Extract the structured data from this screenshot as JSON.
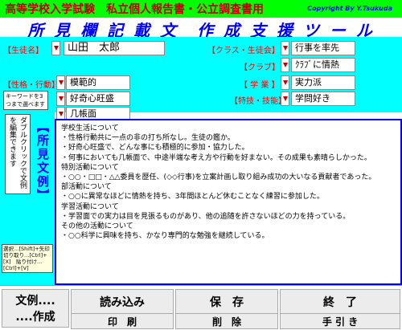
{
  "header": {
    "top_title": "高等学校入学試験　私立個人報告書・公立調査書用",
    "copyright": "Copyright By Y.Tsukuda",
    "main_title": "所 見 欄 記 載 文　作 成 支 援 ツ ー ル"
  },
  "fields": {
    "student_label": "【生徒名】",
    "student_value": "山田　太郎",
    "class_committee_label": "【クラス・生徒会】",
    "class_committee_value": "行事を率先",
    "club_label": "【クラブ】",
    "club_value": "ｸﾗﾌﾞに情熱",
    "personality_label": "【性格・行動】",
    "personality_values": [
      "模範的",
      "好奇心旺盛",
      "几帳面"
    ],
    "study_label": "【 学 業 】",
    "study_value": "実力派",
    "special_label": "【特技・技能】",
    "special_value": "学問好き"
  },
  "left_panel": {
    "keyword_note": "キーワードを3つまで選べます",
    "double_click_note": "ダブルクリックで文例を編集できます",
    "example_title": "【所見文例】",
    "hint": "選択…[Shift]+矢印　切り取り…[Ctrl]+[X]　貼り付け…[Ctrl]+[V]"
  },
  "text_lines": [
    "学校生活について",
    "・性格行動共に一点の非の打ち所なし。生徒の鑑か。",
    "・好奇心旺盛で、どんな事にも積極的に参加・協力した。",
    "・何事においても几帳面で、中途半端な考え方や行動を好まない。その成果も素晴らしかった。",
    "特別活動について",
    "・○○・□□・△△委員を歴任、(◇◇行事)を立案計画し取り組み成功の大いなる貢献者であった。",
    "部活動について",
    "・○○に異常なほどに情熱を持ち、3年間ほとんど休むことなく練習に参加した。",
    "学習活動について",
    "・学習面での実力は目を見張るものがあり、他の追随を許さないほどの力を持っている。",
    "その他の活動について",
    "・○○科学に興味を持ち、かなり専門的な勉強を継続している。"
  ],
  "buttons": {
    "example_label_1": "文例....",
    "example_label_2": "....作成",
    "load": "読み込み",
    "save": "保　存",
    "end": "終　了",
    "print": "印　刷",
    "delete": "削　除",
    "guide": "手 引 き"
  },
  "colors": {
    "accent_green": "#00ff00",
    "panel_cyan": "#00ffff",
    "title_blue": "#0000ff",
    "label_red": "#ff0000"
  }
}
